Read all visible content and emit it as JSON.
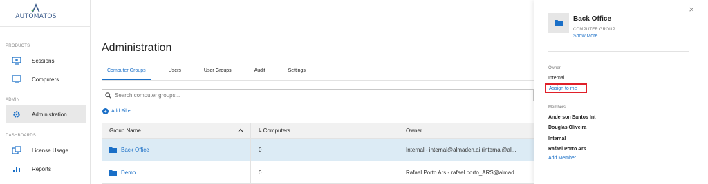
{
  "brand": {
    "logo_text": "AUTOMATOS",
    "accent": "#1a6fc7"
  },
  "sidebar": {
    "sections": [
      {
        "label": "PRODUCTS"
      },
      {
        "label": "ADMIN"
      },
      {
        "label": "DASHBOARDS"
      }
    ],
    "items": [
      {
        "label": "Sessions",
        "icon": "sessions-icon"
      },
      {
        "label": "Computers",
        "icon": "computer-icon"
      },
      {
        "label": "Administration",
        "icon": "gear-icon",
        "active": true
      },
      {
        "label": "License Usage",
        "icon": "license-icon"
      },
      {
        "label": "Reports",
        "icon": "bar-chart-icon"
      }
    ]
  },
  "main": {
    "title": "Administration",
    "tabs": [
      {
        "label": "Computer Groups",
        "active": true
      },
      {
        "label": "Users"
      },
      {
        "label": "User Groups"
      },
      {
        "label": "Audit"
      },
      {
        "label": "Settings"
      }
    ],
    "search": {
      "placeholder": "Search computer groups..."
    },
    "add_filter": "Add Filter",
    "table": {
      "headers": [
        "Group Name",
        "# Computers",
        "Owner"
      ],
      "sort_indicator": "^",
      "rows": [
        {
          "name": "Back Office",
          "computers": "0",
          "owner": "Internal - internal@almaden.ai (internal@al...",
          "selected": true
        },
        {
          "name": "Demo",
          "computers": "0",
          "owner": "Rafael Porto Ars - rafael.porto_ARS@almad..."
        }
      ]
    }
  },
  "panel": {
    "close": "×",
    "group_name": "Back Office",
    "group_type": "COMPUTER GROUP",
    "show_more": "Show More",
    "owner_label": "Owner",
    "owner_value": "Internal",
    "assign_label": "Assign to me",
    "members_label": "Members",
    "members": [
      "Anderson Santos Int",
      "Douglas Oliveira",
      "Internal",
      "Rafael Porto Ars"
    ],
    "add_member": "Add Member"
  }
}
